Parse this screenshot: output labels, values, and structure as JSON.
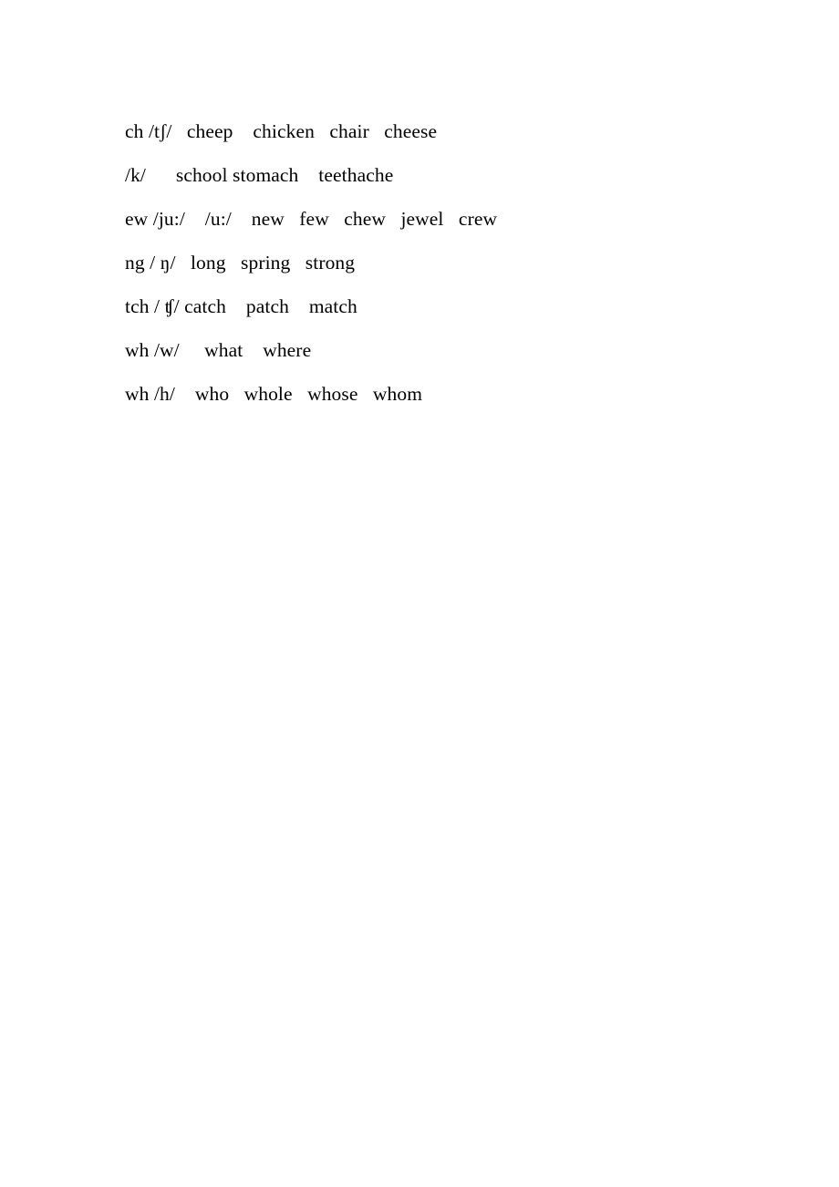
{
  "document": {
    "type": "phonics-worksheet",
    "background_color": "#ffffff",
    "text_color": "#000000",
    "lines": [
      {
        "id": "line-ch",
        "grapheme": "ch",
        "phoneme": "/tʃ/",
        "lead": "ch /tʃ/",
        "examples": [
          "cheep",
          "chicken",
          "chair",
          "cheese"
        ],
        "text": "ch /tʃ/   cheep    chicken   chair   cheese"
      },
      {
        "id": "line-k",
        "grapheme": "",
        "phoneme": "/k/",
        "lead": "/k/",
        "examples": [
          "school",
          "stomach",
          "teethache"
        ],
        "text": "/k/      school stomach    teethache"
      },
      {
        "id": "line-ew",
        "grapheme": "ew",
        "phoneme": "/ju:/",
        "phoneme_alt": "/u:/",
        "lead": "ew /ju:/",
        "examples": [
          "new",
          "few",
          "chew",
          "jewel",
          "crew"
        ],
        "text": "ew /ju:/    /u:/    new   few   chew   jewel   crew"
      },
      {
        "id": "line-ng",
        "grapheme": "ng",
        "phoneme": "/ ŋ/",
        "lead": "ng / ŋ/",
        "examples": [
          "long",
          "spring",
          "strong"
        ],
        "text": "ng / ŋ/   long   spring   strong"
      },
      {
        "id": "line-tch",
        "grapheme": "tch",
        "phoneme": "/ ʧ/",
        "lead": "tch / ʧ/",
        "examples": [
          "catch",
          "patch",
          "match"
        ],
        "text": "tch / ʧ/ catch    patch    match"
      },
      {
        "id": "line-wh-w",
        "grapheme": "wh",
        "phoneme": "/w/",
        "lead": "wh /w/",
        "examples": [
          "what",
          "where"
        ],
        "text": "wh /w/     what    where"
      },
      {
        "id": "line-wh-h",
        "grapheme": "wh",
        "phoneme": "/h/",
        "lead": "wh /h/",
        "examples": [
          "who",
          "whole",
          "whose",
          "whom"
        ],
        "text": "wh /h/    who   whole   whose   whom"
      }
    ]
  }
}
